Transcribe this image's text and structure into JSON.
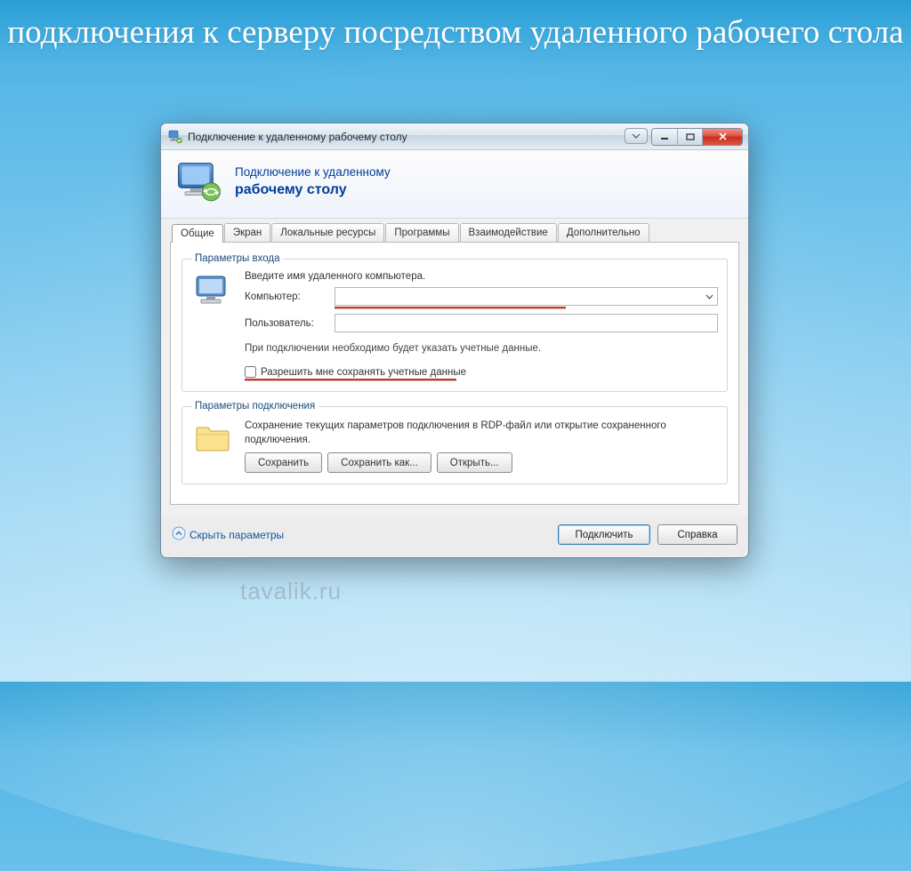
{
  "slide": {
    "title": "подключения к серверу посредством удаленного рабочего стола"
  },
  "window": {
    "title": "Подключение к удаленному рабочему столу",
    "header_line1": "Подключение к удаленному",
    "header_line2": "рабочему столу"
  },
  "tabs": [
    {
      "label": "Общие",
      "active": true
    },
    {
      "label": "Экран",
      "active": false
    },
    {
      "label": "Локальные ресурсы",
      "active": false
    },
    {
      "label": "Программы",
      "active": false
    },
    {
      "label": "Взаимодействие",
      "active": false
    },
    {
      "label": "Дополнительно",
      "active": false
    }
  ],
  "login_group": {
    "legend": "Параметры входа",
    "intro": "Введите имя удаленного компьютера.",
    "computer_label": "Компьютер:",
    "computer_value": "",
    "user_label": "Пользователь:",
    "user_value": "",
    "hint": "При подключении необходимо будет указать учетные данные.",
    "checkbox": "Разрешить мне сохранять учетные данные"
  },
  "conn_group": {
    "legend": "Параметры подключения",
    "text": "Сохранение текущих параметров подключения в RDP-файл или открытие сохраненного подключения.",
    "save": "Сохранить",
    "save_as": "Сохранить как...",
    "open": "Открыть..."
  },
  "footer": {
    "hide_params": "Скрыть параметры",
    "connect": "Подключить",
    "help": "Справка"
  },
  "watermark": "tavalik.ru"
}
